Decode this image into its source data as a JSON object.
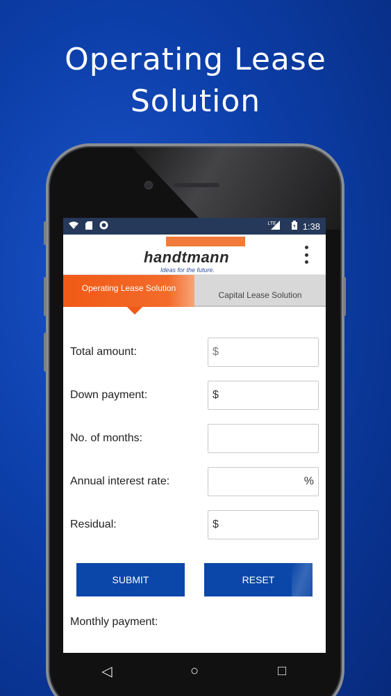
{
  "headline": {
    "line1": "Operating Lease",
    "line2": "Solution"
  },
  "status_bar": {
    "left_icons": [
      "wifi-unknown-icon",
      "sd-card-icon",
      "record-icon"
    ],
    "network": "LTE",
    "time": "1:38"
  },
  "app_bar": {
    "logo_text": "handtmann",
    "logo_tagline": "Ideas for the future.",
    "menu_icon": "more-vert-icon"
  },
  "tabs": [
    {
      "label": "Operating Lease Solution",
      "active": true
    },
    {
      "label": "Capital Lease Solution",
      "active": false
    }
  ],
  "form": {
    "total_amount": {
      "label": "Total amount:",
      "prefix": "$",
      "value": ""
    },
    "down_payment": {
      "label": "Down payment:",
      "prefix": "$",
      "value": ""
    },
    "months": {
      "label": "No. of months:",
      "value": ""
    },
    "interest": {
      "label": "Annual interest rate:",
      "suffix": "%",
      "value": ""
    },
    "residual": {
      "label": "Residual:",
      "prefix": "$",
      "value": ""
    }
  },
  "buttons": {
    "submit": "SUBMIT",
    "reset": "RESET"
  },
  "result": {
    "monthly_label": "Monthly payment:",
    "monthly_value": ""
  },
  "nav": {
    "back": "◁",
    "home": "○",
    "recents": "□"
  },
  "colors": {
    "brand_blue": "#0b47a8",
    "brand_orange": "#f05a16",
    "status_bar": "#26395a"
  }
}
